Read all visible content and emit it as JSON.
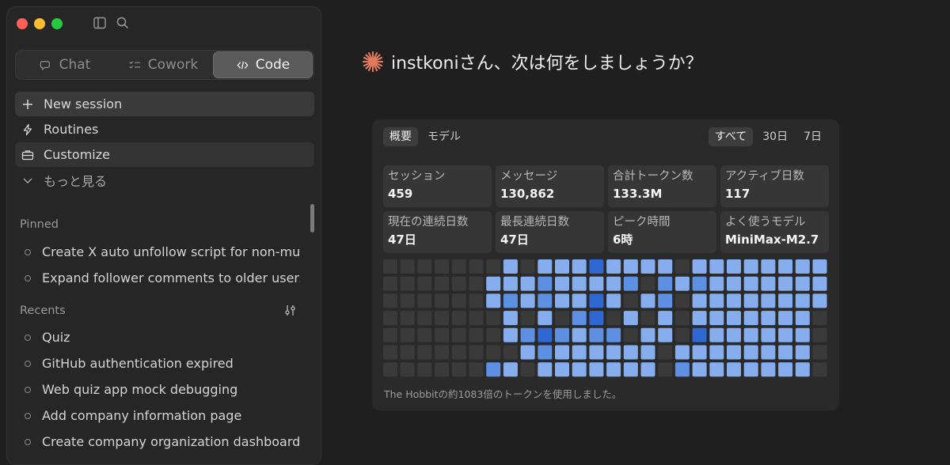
{
  "sidebar": {
    "segments": [
      {
        "label": "Chat",
        "icon": "chat-bubbles-icon",
        "active": false
      },
      {
        "label": "Cowork",
        "icon": "checklist-icon",
        "active": false
      },
      {
        "label": "Code",
        "icon": "code-brackets-icon",
        "active": true
      }
    ],
    "nav": [
      {
        "label": "New session",
        "icon": "plus-icon"
      },
      {
        "label": "Routines",
        "icon": "lightning-icon"
      },
      {
        "label": "Customize",
        "icon": "briefcase-icon"
      },
      {
        "label": "もっと見る",
        "icon": "chevron-down-icon"
      }
    ],
    "pinned_title": "Pinned",
    "pinned": [
      "Create X auto unfollow script for non-mutu",
      "Expand follower comments to older users"
    ],
    "recents_title": "Recents",
    "recents": [
      "Quiz",
      "GitHub authentication expired",
      "Web quiz app mock debugging",
      "Add company information page",
      "Create company organization dashboard"
    ]
  },
  "main": {
    "greeting": "instkoniさん、次は何をしましょうか？",
    "accent": "#e07a5f",
    "stats_card": {
      "tabs_left": [
        {
          "label": "概要",
          "active": true
        },
        {
          "label": "モデル",
          "active": false
        }
      ],
      "tabs_right": [
        {
          "label": "すべて",
          "active": true
        },
        {
          "label": "30日",
          "active": false
        },
        {
          "label": "7日",
          "active": false
        }
      ],
      "stats": [
        {
          "label": "セッション",
          "value": "459"
        },
        {
          "label": "メッセージ",
          "value": "130,862"
        },
        {
          "label": "合計トークン数",
          "value": "133.3M"
        },
        {
          "label": "アクティブ日数",
          "value": "117"
        },
        {
          "label": "現在の連続日数",
          "value": "47日"
        },
        {
          "label": "最長連続日数",
          "value": "47日"
        },
        {
          "label": "ピーク時間",
          "value": "6時"
        },
        {
          "label": "よく使うモデル",
          "value": "MiniMax-M2.7"
        }
      ],
      "heatmap_palette": [
        "#3a3a3a",
        "#a9c8f4",
        "#86aeee",
        "#5d8fe3",
        "#2f67d3"
      ],
      "heatmap_levels": [
        [
          0,
          0,
          0,
          0,
          0,
          0,
          0,
          2,
          0,
          2,
          2,
          2,
          4,
          2,
          2,
          2,
          2,
          0,
          2,
          2,
          2,
          2,
          2,
          2,
          2,
          2
        ],
        [
          0,
          0,
          0,
          0,
          0,
          0,
          2,
          2,
          2,
          3,
          2,
          2,
          2,
          2,
          3,
          0,
          3,
          2,
          3,
          2,
          2,
          2,
          2,
          2,
          2,
          2
        ],
        [
          0,
          0,
          0,
          0,
          0,
          0,
          2,
          3,
          2,
          3,
          2,
          2,
          4,
          2,
          0,
          2,
          3,
          0,
          2,
          2,
          2,
          2,
          2,
          2,
          2,
          2
        ],
        [
          0,
          0,
          0,
          0,
          0,
          0,
          0,
          2,
          0,
          2,
          0,
          3,
          4,
          0,
          2,
          0,
          2,
          0,
          2,
          2,
          2,
          2,
          2,
          2,
          2,
          0
        ],
        [
          0,
          0,
          0,
          0,
          0,
          0,
          0,
          2,
          3,
          4,
          3,
          2,
          3,
          3,
          0,
          2,
          2,
          0,
          4,
          2,
          2,
          2,
          2,
          2,
          2,
          0
        ],
        [
          0,
          0,
          0,
          0,
          0,
          0,
          0,
          0,
          2,
          3,
          2,
          2,
          2,
          2,
          2,
          2,
          0,
          2,
          2,
          2,
          2,
          2,
          2,
          2,
          2,
          0
        ],
        [
          0,
          0,
          0,
          0,
          0,
          0,
          3,
          2,
          0,
          2,
          2,
          2,
          2,
          2,
          2,
          2,
          0,
          3,
          2,
          2,
          2,
          2,
          2,
          2,
          2,
          0
        ]
      ],
      "footnote": "The Hobbitの約1083倍のトークンを使用しました。"
    }
  }
}
